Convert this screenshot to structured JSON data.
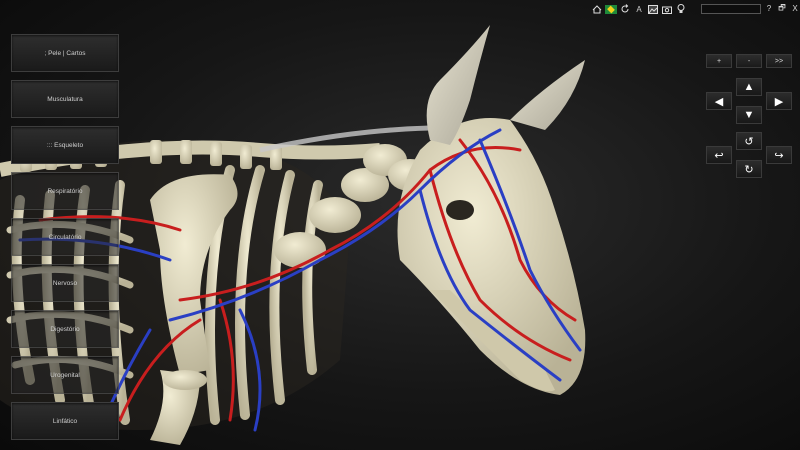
{
  "sidebar": {
    "items": [
      {
        "label": "; Pele | Cartos"
      },
      {
        "label": "Musculatura"
      },
      {
        "label": "::: Esqueleto"
      },
      {
        "label": "Respiratório"
      },
      {
        "label": "Circulatório"
      },
      {
        "label": "Nervoso"
      },
      {
        "label": "Digestório"
      },
      {
        "label": "Urogenital"
      },
      {
        "label": "Linfático"
      }
    ]
  },
  "toolbar": {
    "icons": [
      "home-icon",
      "brazil-flag-icon",
      "refresh-icon",
      "text-icon",
      "image-icon",
      "camera-icon",
      "lightbulb-icon"
    ],
    "text_label": "A",
    "search_value": "",
    "help_label": "?",
    "restore_label": "🗗",
    "close_label": "X"
  },
  "controls": {
    "zoom_in_label": "+",
    "zoom_out_label": "-",
    "next_label": ">>",
    "up": "▲",
    "down": "▼",
    "left": "◀",
    "right": "▶",
    "rotate_up": "↺",
    "rotate_down": "↻",
    "rotate_left": "↩",
    "rotate_right": "↪"
  },
  "colors": {
    "bone": "#dcd6b8",
    "artery": "#c81e1e",
    "vein": "#2a3fc4",
    "background": "#1a1a1a"
  }
}
